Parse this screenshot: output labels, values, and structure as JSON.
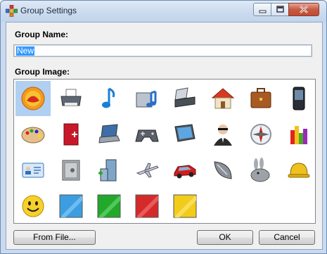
{
  "window": {
    "title": "Group Settings"
  },
  "form": {
    "name_label": "Group Name:",
    "name_value": "New",
    "image_label": "Group Image:"
  },
  "icons": [
    "fruit-bowl-icon",
    "printer-icon",
    "music-note-icon",
    "music-folder-icon",
    "scanner-icon",
    "house-icon",
    "briefcase-icon",
    "mobile-phone-icon",
    "paint-palette-icon",
    "red-book-icon",
    "laptop-icon",
    "gamepad-icon",
    "monitor-icon",
    "spy-user-icon",
    "compass-icon",
    "bar-chart-icon",
    "id-card-icon",
    "safe-icon",
    "office-building-icon",
    "airplane-icon",
    "red-car-icon",
    "satellite-dish-icon",
    "rabbit-icon",
    "hard-hat-icon",
    "smiley-face-icon",
    "blue-square-icon",
    "green-square-icon",
    "red-square-icon",
    "yellow-square-icon"
  ],
  "selected_icon": "fruit-bowl-icon",
  "buttons": {
    "from_file": "From File...",
    "ok": "OK",
    "cancel": "Cancel"
  }
}
